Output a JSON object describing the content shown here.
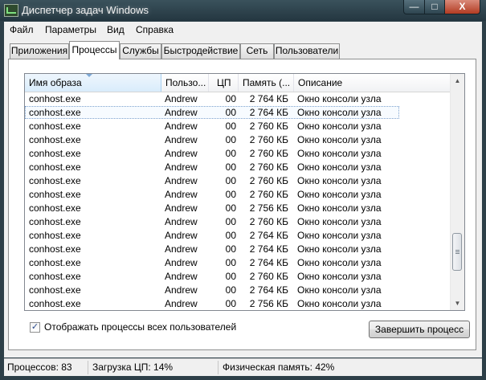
{
  "window": {
    "title": "Диспетчер задач Windows",
    "min_label": "—",
    "max_label": "□",
    "close_label": "X"
  },
  "menu": [
    "Файл",
    "Параметры",
    "Вид",
    "Справка"
  ],
  "tabs": [
    "Приложения",
    "Процессы",
    "Службы",
    "Быстродействие",
    "Сеть",
    "Пользователи"
  ],
  "active_tab": "Процессы",
  "table": {
    "columns": [
      "Имя образа",
      "Пользо...",
      "ЦП",
      "Память (...",
      "Описание"
    ],
    "sorted_column": "Имя образа",
    "rows": [
      {
        "name": "conhost.exe",
        "user": "Andrew",
        "cpu": "00",
        "mem": "2 764 КБ",
        "desc": "Окно консоли узла"
      },
      {
        "name": "conhost.exe",
        "user": "Andrew",
        "cpu": "00",
        "mem": "2 764 КБ",
        "desc": "Окно консоли узла"
      },
      {
        "name": "conhost.exe",
        "user": "Andrew",
        "cpu": "00",
        "mem": "2 760 КБ",
        "desc": "Окно консоли узла"
      },
      {
        "name": "conhost.exe",
        "user": "Andrew",
        "cpu": "00",
        "mem": "2 760 КБ",
        "desc": "Окно консоли узла"
      },
      {
        "name": "conhost.exe",
        "user": "Andrew",
        "cpu": "00",
        "mem": "2 760 КБ",
        "desc": "Окно консоли узла"
      },
      {
        "name": "conhost.exe",
        "user": "Andrew",
        "cpu": "00",
        "mem": "2 760 КБ",
        "desc": "Окно консоли узла"
      },
      {
        "name": "conhost.exe",
        "user": "Andrew",
        "cpu": "00",
        "mem": "2 760 КБ",
        "desc": "Окно консоли узла"
      },
      {
        "name": "conhost.exe",
        "user": "Andrew",
        "cpu": "00",
        "mem": "2 760 КБ",
        "desc": "Окно консоли узла"
      },
      {
        "name": "conhost.exe",
        "user": "Andrew",
        "cpu": "00",
        "mem": "2 756 КБ",
        "desc": "Окно консоли узла"
      },
      {
        "name": "conhost.exe",
        "user": "Andrew",
        "cpu": "00",
        "mem": "2 760 КБ",
        "desc": "Окно консоли узла"
      },
      {
        "name": "conhost.exe",
        "user": "Andrew",
        "cpu": "00",
        "mem": "2 764 КБ",
        "desc": "Окно консоли узла"
      },
      {
        "name": "conhost.exe",
        "user": "Andrew",
        "cpu": "00",
        "mem": "2 764 КБ",
        "desc": "Окно консоли узла"
      },
      {
        "name": "conhost.exe",
        "user": "Andrew",
        "cpu": "00",
        "mem": "2 764 КБ",
        "desc": "Окно консоли узла"
      },
      {
        "name": "conhost.exe",
        "user": "Andrew",
        "cpu": "00",
        "mem": "2 760 КБ",
        "desc": "Окно консоли узла"
      },
      {
        "name": "conhost.exe",
        "user": "Andrew",
        "cpu": "00",
        "mem": "2 764 КБ",
        "desc": "Окно консоли узла"
      },
      {
        "name": "conhost.exe",
        "user": "Andrew",
        "cpu": "00",
        "mem": "2 756 КБ",
        "desc": "Окно консоли узла"
      }
    ],
    "focused_row": 1
  },
  "scroll": {
    "position_fraction": 0.85,
    "visible_fraction": 0.18
  },
  "show_all_users": {
    "label": "Отображать процессы всех пользователей",
    "checked": true,
    "mark": "✓"
  },
  "end_process_button": "Завершить процесс",
  "status": {
    "processes": "Процессов: 83",
    "cpu": "Загрузка ЦП: 14%",
    "memory": "Физическая память: 42%"
  },
  "colors": {
    "titlebar": "#2d3f48",
    "focus_border": "#7da2ce",
    "sort_header": "#d9ecfb"
  }
}
